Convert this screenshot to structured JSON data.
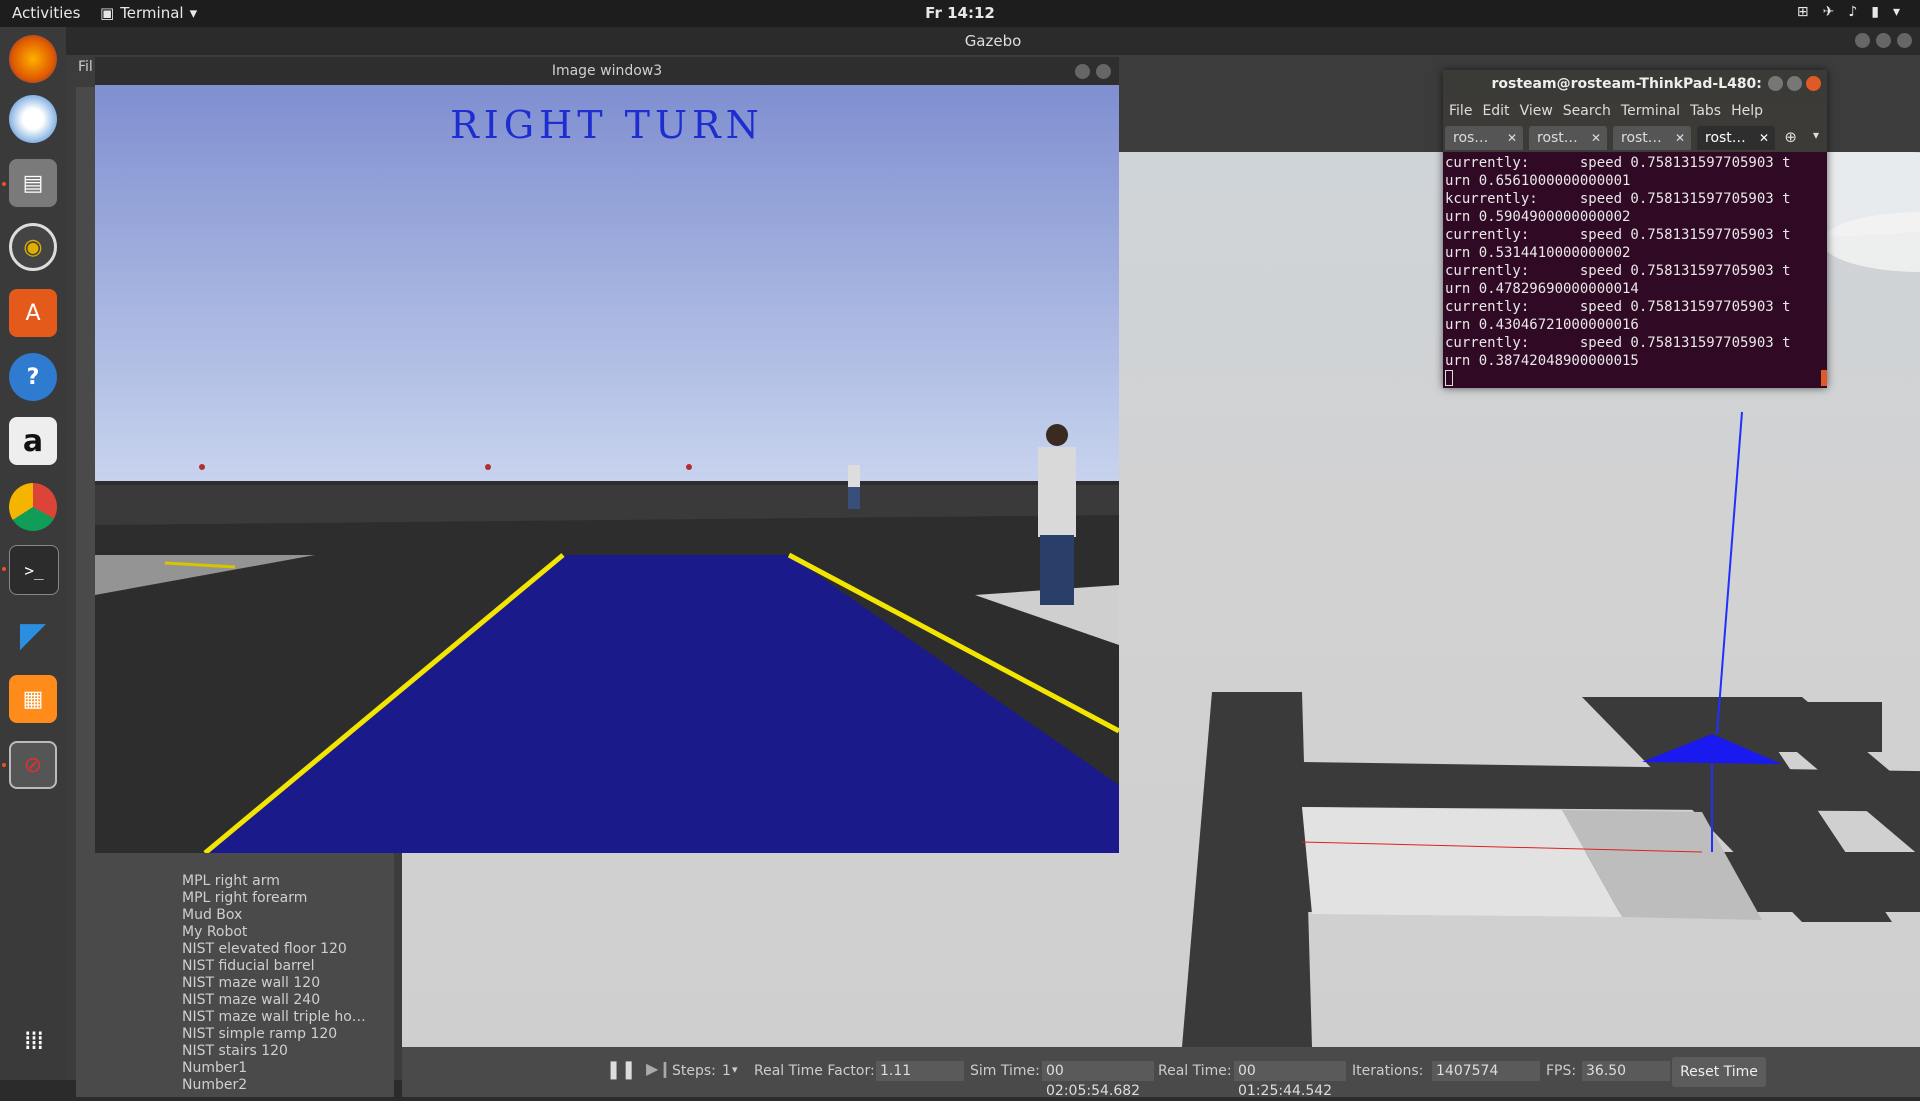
{
  "topbar": {
    "activities": "Activities",
    "app_name": "Terminal",
    "clock": "Fr 14:12",
    "tray_icons": [
      "network-icon",
      "airplane-icon",
      "volume-icon",
      "battery-icon",
      "power-icon"
    ]
  },
  "dock": {
    "items": [
      "firefox-icon",
      "thunderbird-icon",
      "files-icon",
      "rhythmbox-icon",
      "software-center-icon",
      "help-icon",
      "amazon-icon",
      "chrome-icon",
      "terminal-icon",
      "vscode-icon",
      "virtualbox-icon",
      "update-icon",
      "show-apps-icon"
    ]
  },
  "gazebo": {
    "title": "Gazebo",
    "menu_first": "Fil",
    "models": [
      "MPL right arm",
      "MPL right forearm",
      "Mud Box",
      "My Robot",
      "NIST elevated floor 120",
      "NIST fiducial barrel",
      "NIST maze wall 120",
      "NIST maze wall 240",
      "NIST maze wall triple ho…",
      "NIST simple ramp 120",
      "NIST stairs 120",
      "Number1",
      "Number2"
    ],
    "bottom": {
      "steps_label": "Steps:",
      "steps_value": "1",
      "rtf_label": "Real Time Factor:",
      "rtf_value": "1.11",
      "sim_label": "Sim Time:",
      "sim_value": "00 02:05:54.682",
      "real_label": "Real Time:",
      "real_value": "00 01:25:44.542",
      "iter_label": "Iterations:",
      "iter_value": "1407574",
      "fps_label": "FPS:",
      "fps_value": "36.50",
      "reset_label": "Reset Time"
    }
  },
  "image_window": {
    "title": "Image window3",
    "overlay_text": "RIGHT TURN",
    "colors": {
      "lane_fill": "#1a1a8a",
      "lane_lines": "#f2e600",
      "label": "#1e2dd0"
    }
  },
  "terminal": {
    "title": "rosteam@rosteam-ThinkPad-L480: ~",
    "menu": [
      "File",
      "Edit",
      "View",
      "Search",
      "Terminal",
      "Tabs",
      "Help"
    ],
    "tabs": [
      "ros…",
      "rost…",
      "rost…",
      "rost…"
    ],
    "lines": [
      "currently:      speed 0.758131597705903 t",
      "urn 0.6561000000000001",
      "kcurrently:     speed 0.758131597705903 t",
      "urn 0.5904900000000002",
      "currently:      speed 0.758131597705903 t",
      "urn 0.5314410000000002",
      "currently:      speed 0.758131597705903 t",
      "urn 0.47829690000000014",
      "currently:      speed 0.758131597705903 t",
      "urn 0.43046721000000016",
      "currently:      speed 0.758131597705903 t",
      "urn 0.38742048900000015"
    ]
  }
}
